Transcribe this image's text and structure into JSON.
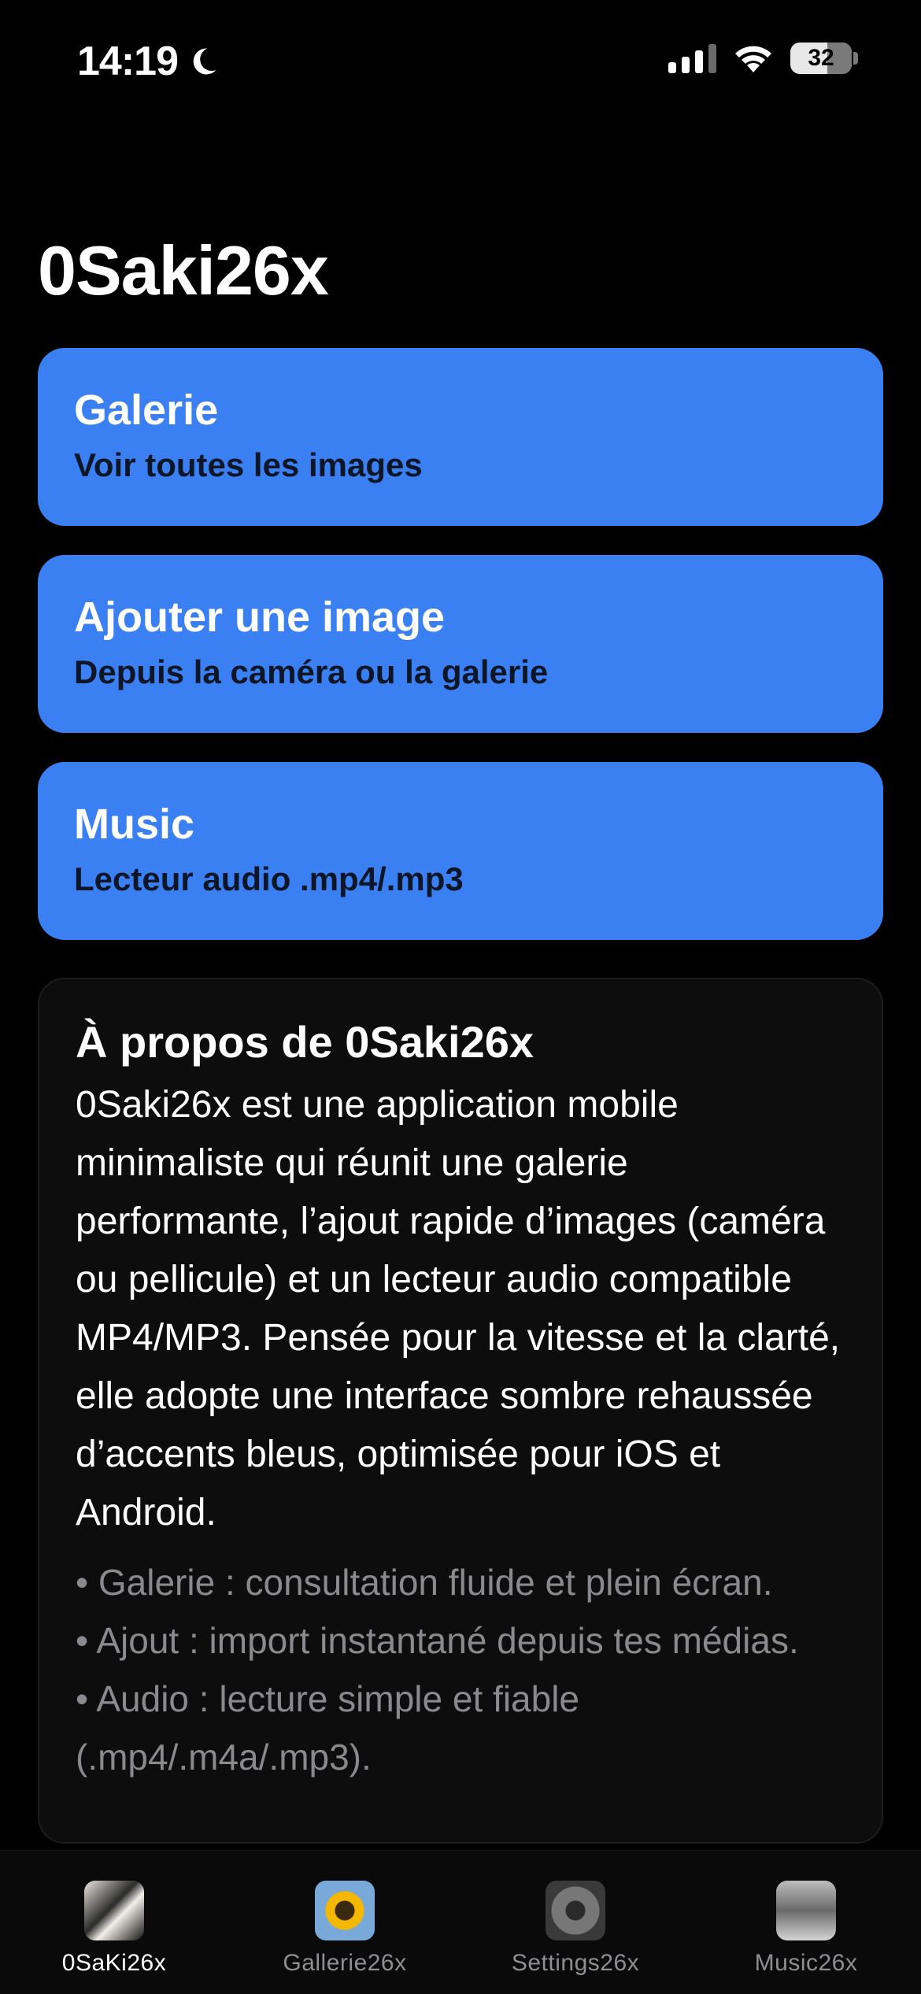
{
  "status_bar": {
    "time": "14:19",
    "battery": "32",
    "icons": [
      "moon-icon",
      "signal-icon",
      "wifi-icon",
      "battery-icon"
    ]
  },
  "page_title": "0Saki26x",
  "accent_color": "#3b80f2",
  "cards": [
    {
      "title": "Galerie",
      "subtitle": "Voir toutes les images"
    },
    {
      "title": "Ajouter une image",
      "subtitle": "Depuis la caméra ou la galerie"
    },
    {
      "title": "Music",
      "subtitle": "Lecteur audio .mp4/.mp3"
    }
  ],
  "about": {
    "title": "À propos de 0Saki26x",
    "body": "0Saki26x est une application mobile minimaliste qui réunit une galerie performante, l’ajout rapide d’images (caméra ou pellicule) et un lecteur audio compatible MP4/MP3. Pensée pour la vitesse et la clarté, elle adopte une interface sombre rehaussée d’accents bleus, optimisée pour iOS et Android.",
    "bullets": [
      "• Galerie : consultation fluide et plein écran.",
      "• Ajout : import instantané depuis tes médias.",
      "• Audio : lecture simple et fiable (.mp4/.m4a/.mp3)."
    ]
  },
  "tabs": [
    {
      "label": "0SaKi26x",
      "icon": "app-thumbnail-icon",
      "active": true
    },
    {
      "label": "Gallerie26x",
      "icon": "sunflower-icon",
      "active": false
    },
    {
      "label": "Settings26x",
      "icon": "gear-icon",
      "active": false
    },
    {
      "label": "Music26x",
      "icon": "music-thumbnail-icon",
      "active": false
    }
  ]
}
